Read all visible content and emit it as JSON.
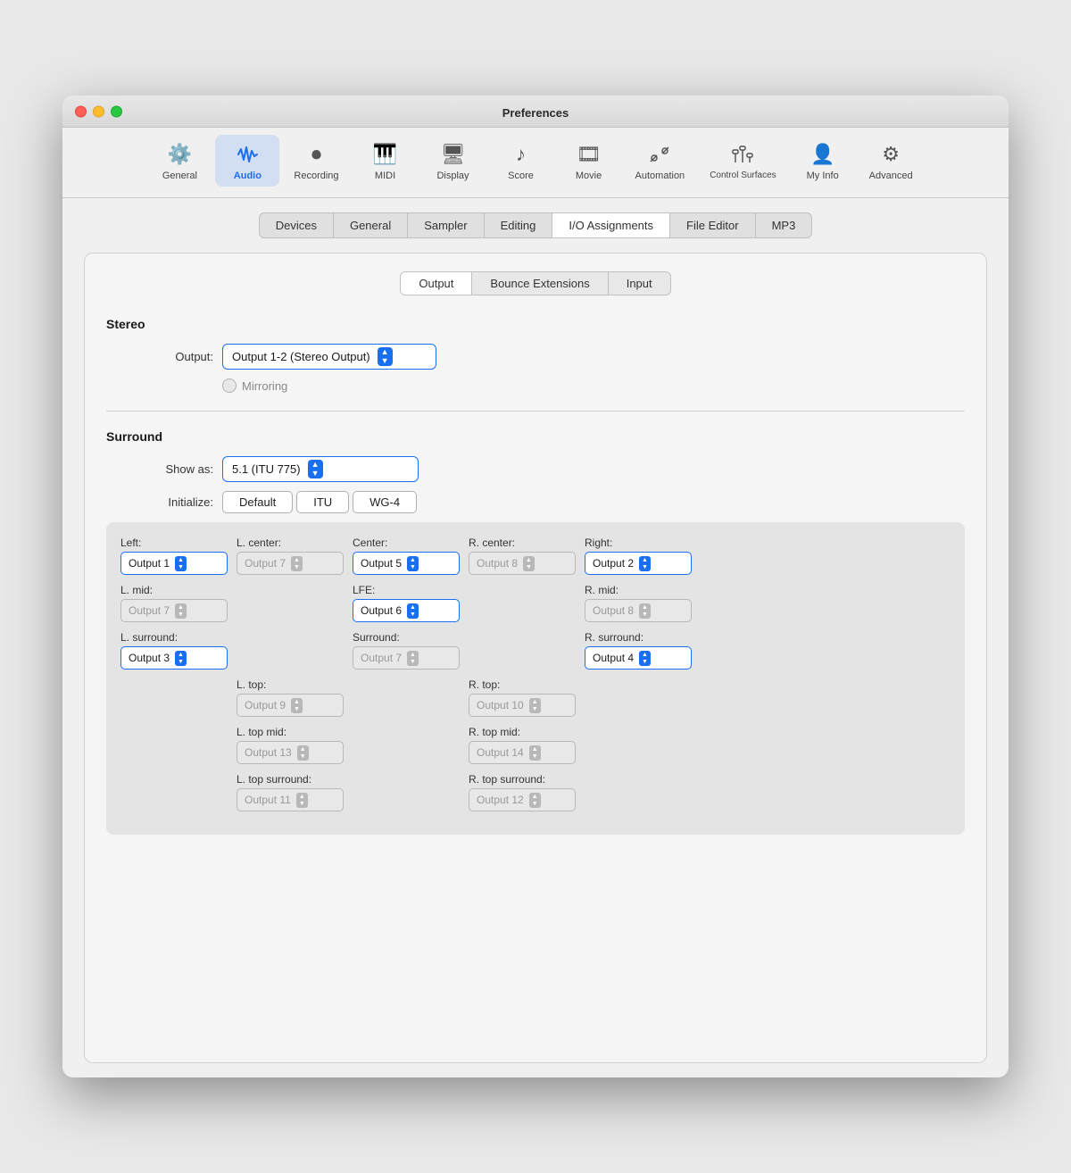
{
  "window": {
    "title": "Preferences"
  },
  "toolbar": {
    "items": [
      {
        "id": "general",
        "label": "General",
        "icon": "⚙",
        "active": false
      },
      {
        "id": "audio",
        "label": "Audio",
        "icon": "📊",
        "active": true
      },
      {
        "id": "recording",
        "label": "Recording",
        "icon": "⏺",
        "active": false
      },
      {
        "id": "midi",
        "label": "MIDI",
        "icon": "🎹",
        "active": false
      },
      {
        "id": "display",
        "label": "Display",
        "icon": "🖥",
        "active": false
      },
      {
        "id": "score",
        "label": "Score",
        "icon": "♪♪",
        "active": false
      },
      {
        "id": "movie",
        "label": "Movie",
        "icon": "🎞",
        "active": false
      },
      {
        "id": "automation",
        "label": "Automation",
        "icon": "✂",
        "active": false
      },
      {
        "id": "control-surfaces",
        "label": "Control Surfaces",
        "icon": "🎚",
        "active": false
      },
      {
        "id": "my-info",
        "label": "My Info",
        "icon": "👤",
        "active": false
      },
      {
        "id": "advanced",
        "label": "Advanced",
        "icon": "⚙✦",
        "active": false
      }
    ]
  },
  "tabs": {
    "items": [
      {
        "id": "devices",
        "label": "Devices",
        "active": false
      },
      {
        "id": "general-tab",
        "label": "General",
        "active": false
      },
      {
        "id": "sampler",
        "label": "Sampler",
        "active": false
      },
      {
        "id": "editing",
        "label": "Editing",
        "active": false
      },
      {
        "id": "io-assignments",
        "label": "I/O Assignments",
        "active": true
      },
      {
        "id": "file-editor",
        "label": "File Editor",
        "active": false
      },
      {
        "id": "mp3",
        "label": "MP3",
        "active": false
      }
    ]
  },
  "sub_tabs": {
    "items": [
      {
        "id": "output",
        "label": "Output",
        "active": true
      },
      {
        "id": "bounce-extensions",
        "label": "Bounce Extensions",
        "active": false
      },
      {
        "id": "input",
        "label": "Input",
        "active": false
      }
    ]
  },
  "stereo": {
    "title": "Stereo",
    "output_label": "Output:",
    "output_value": "Output 1-2 (Stereo Output)",
    "mirroring_label": "Mirroring"
  },
  "surround": {
    "title": "Surround",
    "show_as_label": "Show as:",
    "show_as_value": "5.1 (ITU 775)",
    "initialize_label": "Initialize:",
    "init_buttons": [
      "Default",
      "ITU",
      "WG-4"
    ],
    "channels": {
      "left_label": "Left:",
      "left_value": "Output 1",
      "left_active": true,
      "lcenter_label": "L. center:",
      "lcenter_value": "Output 7",
      "lcenter_disabled": true,
      "center_label": "Center:",
      "center_value": "Output 5",
      "center_active": true,
      "rcenter_label": "R. center:",
      "rcenter_value": "Output 8",
      "rcenter_disabled": true,
      "right_label": "Right:",
      "right_value": "Output 2",
      "right_active": true,
      "lmid_label": "L. mid:",
      "lmid_value": "Output 7",
      "lmid_disabled": true,
      "lfe_label": "LFE:",
      "lfe_value": "Output 6",
      "lfe_active": true,
      "rmid_label": "R. mid:",
      "rmid_value": "Output 8",
      "rmid_disabled": true,
      "lsurround_label": "L. surround:",
      "lsurround_value": "Output 3",
      "lsurround_active": true,
      "surround_label": "Surround:",
      "surround_value": "Output 7",
      "surround_disabled": true,
      "rsurround_label": "R. surround:",
      "rsurround_value": "Output 4",
      "rsurround_active": true,
      "ltop_label": "L. top:",
      "ltop_value": "Output 9",
      "ltop_disabled": true,
      "rtop_label": "R. top:",
      "rtop_value": "Output 10",
      "rtop_disabled": true,
      "ltopmid_label": "L. top mid:",
      "ltopmid_value": "Output 13",
      "ltopmid_disabled": true,
      "rtopmid_label": "R. top mid:",
      "rtopmid_value": "Output 14",
      "rtopmid_disabled": true,
      "ltopsurround_label": "L. top surround:",
      "ltopsurround_value": "Output 11",
      "ltopsurround_disabled": true,
      "rtopsurround_label": "R. top surround:",
      "rtopsurround_value": "Output 12",
      "rtopsurround_disabled": true
    }
  }
}
